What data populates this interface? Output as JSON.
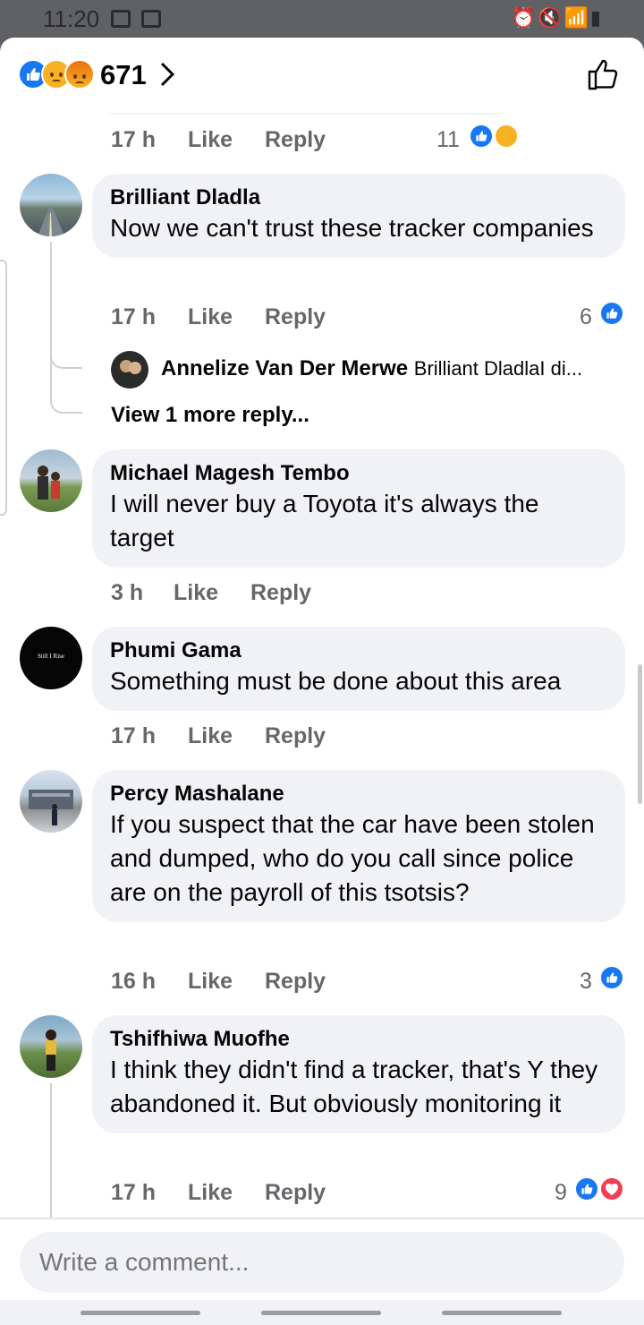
{
  "status_bar": {
    "time": "11:20"
  },
  "header": {
    "reaction_count": "671"
  },
  "first_comment_tail": {
    "time": "17 h",
    "like": "Like",
    "reply": "Reply",
    "reactions": "11"
  },
  "comments": [
    {
      "name": "Brilliant Dladla",
      "text": "Now we can't trust these tracker companies",
      "time": "17 h",
      "like": "Like",
      "reply": "Reply",
      "reactions": "6"
    },
    {
      "name": "Michael Magesh Tembo",
      "text": "I will never buy a Toyota it's always the target",
      "time": "3 h",
      "like": "Like",
      "reply": "Reply",
      "reactions": ""
    },
    {
      "name": "Phumi Gama",
      "text": "Something must be done about this area",
      "time": "17 h",
      "like": "Like",
      "reply": "Reply",
      "reactions": "",
      "avatar_text": "Still I Rise"
    },
    {
      "name": "Percy Mashalane",
      "text": "If you suspect that the car have been stolen and dumped, who do you call since police are on the payroll of this tsotsis?",
      "time": "16 h",
      "like": "Like",
      "reply": "Reply",
      "reactions": "3"
    },
    {
      "name": "Tshifhiwa Muofhe",
      "text": "I think they didn't find a tracker, that's Y they abandoned it. But obviously monitoring it",
      "time": "17 h",
      "like": "Like",
      "reply": "Reply",
      "reactions": "9"
    }
  ],
  "nested_reply": {
    "name": "Annelize Van Der Merwe",
    "snippet": "Brilliant DladlaI di..."
  },
  "view_more": "View 1 more reply...",
  "composer": {
    "placeholder": "Write a comment..."
  },
  "colors": {
    "accent": "#1877f2",
    "bubble": "#f0f2f5",
    "meta": "#65676b"
  }
}
